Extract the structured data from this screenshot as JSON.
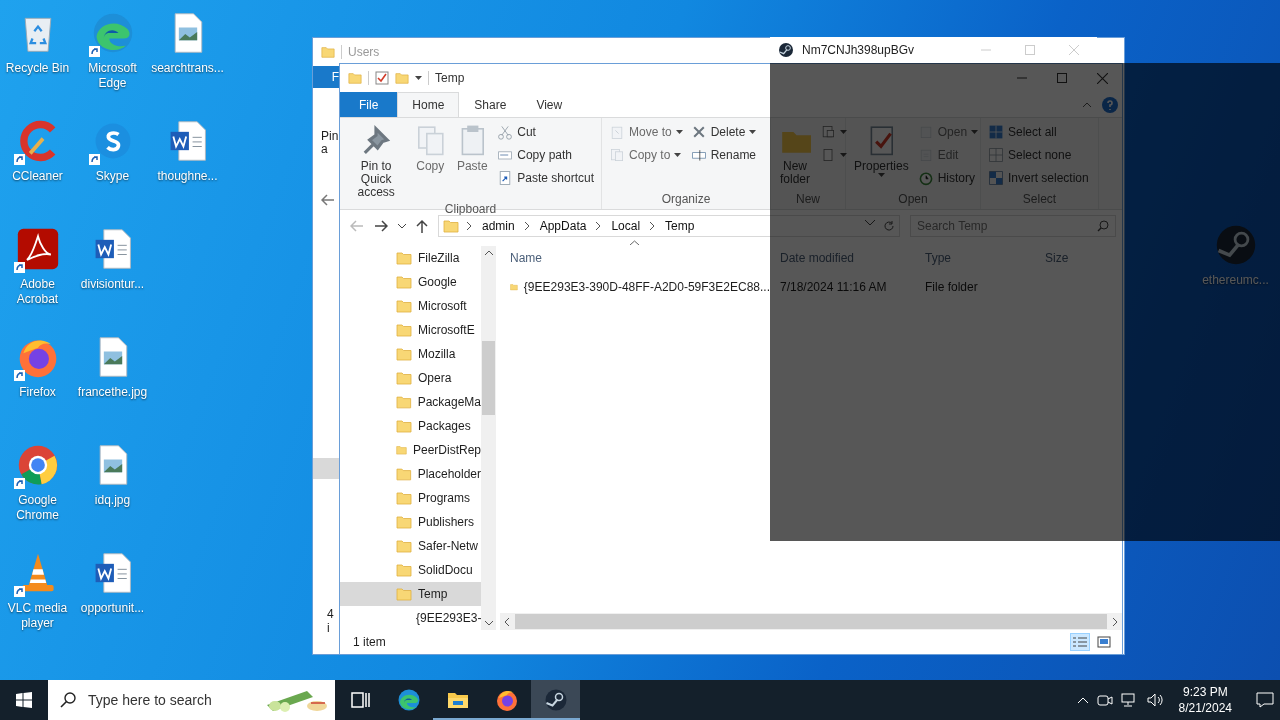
{
  "desktop_columns": [
    [
      {
        "label": "Recycle Bin",
        "kind": "recycle",
        "shortcut": false
      },
      {
        "label": "CCleaner",
        "kind": "ccleaner",
        "shortcut": true
      },
      {
        "label": "Adobe Acrobat",
        "kind": "acrobat",
        "shortcut": true
      },
      {
        "label": "Firefox",
        "kind": "firefox",
        "shortcut": true
      },
      {
        "label": "Google Chrome",
        "kind": "chrome",
        "shortcut": true
      },
      {
        "label": "VLC media player",
        "kind": "vlc",
        "shortcut": true
      }
    ],
    [
      {
        "label": "Microsoft Edge",
        "kind": "edge",
        "shortcut": true
      },
      {
        "label": "Skype",
        "kind": "skype",
        "shortcut": true
      },
      {
        "label": "divisiontur...",
        "kind": "word",
        "shortcut": false
      },
      {
        "label": "francethe.jpg",
        "kind": "image",
        "shortcut": false
      },
      {
        "label": "idq.jpg",
        "kind": "image",
        "shortcut": false
      },
      {
        "label": "opportunit...",
        "kind": "word",
        "shortcut": false
      }
    ],
    [
      {
        "label": "searchtrans...",
        "kind": "image",
        "shortcut": false
      },
      {
        "label": "thoughne...",
        "kind": "word",
        "shortcut": false
      }
    ]
  ],
  "right_icons": [
    {
      "label": "ethereumc...",
      "kind": "steam",
      "shortcut": false
    }
  ],
  "back_window": {
    "title": "Users",
    "file_tab": "F",
    "ribbon_lines": [
      "Pin",
      "a"
    ],
    "status": "4 i"
  },
  "explorer": {
    "title": "Temp",
    "tabs": [
      {
        "label": "File",
        "kind": "file",
        "selected": false
      },
      {
        "label": "Home",
        "kind": "tab",
        "selected": true
      },
      {
        "label": "Share",
        "kind": "tab",
        "selected": false
      },
      {
        "label": "View",
        "kind": "tab",
        "selected": false
      }
    ],
    "ribbon_groups": [
      {
        "label": "Clipboard",
        "columns": [
          [
            {
              "label": "Pin to Quick access",
              "kind": "large",
              "disabled": false,
              "menu": false
            }
          ],
          [
            {
              "label": "Copy",
              "kind": "large",
              "disabled": true,
              "menu": false
            }
          ],
          [
            {
              "label": "Paste",
              "kind": "large",
              "disabled": true,
              "menu": false
            }
          ],
          [
            {
              "label": "Cut",
              "kind": "small",
              "disabled": false,
              "menu": false
            },
            {
              "label": "Copy path",
              "kind": "small",
              "disabled": false,
              "menu": false
            },
            {
              "label": "Paste shortcut",
              "kind": "small",
              "disabled": false,
              "menu": false
            }
          ]
        ]
      },
      {
        "label": "Organize",
        "columns": [
          [
            {
              "label": "Move to",
              "kind": "small",
              "disabled": true,
              "menu": true
            },
            {
              "label": "Copy to",
              "kind": "small",
              "disabled": true,
              "menu": true
            }
          ],
          [
            {
              "label": "Delete",
              "kind": "small",
              "disabled": false,
              "menu": true
            },
            {
              "label": "Rename",
              "kind": "small",
              "disabled": false,
              "menu": false
            }
          ]
        ]
      },
      {
        "label": "New",
        "columns": [
          [
            {
              "label": "New folder",
              "kind": "large",
              "disabled": false,
              "menu": false
            }
          ],
          [
            {
              "kind": "small",
              "disabled": false,
              "menu": true
            },
            {
              "kind": "small",
              "disabled": false,
              "menu": true
            }
          ]
        ]
      },
      {
        "label": "Open",
        "columns": [
          [
            {
              "label": "Properties",
              "kind": "large",
              "disabled": false,
              "menu": true
            }
          ],
          [
            {
              "label": "Open",
              "kind": "small",
              "disabled": true,
              "menu": true
            },
            {
              "label": "Edit",
              "kind": "small",
              "disabled": true,
              "menu": false
            },
            {
              "label": "History",
              "kind": "small",
              "disabled": false,
              "menu": false
            }
          ]
        ]
      },
      {
        "label": "Select",
        "columns": [
          [
            {
              "label": "Select all",
              "kind": "small",
              "disabled": false,
              "menu": false
            },
            {
              "label": "Select none",
              "kind": "small",
              "disabled": false,
              "menu": false
            },
            {
              "label": "Invert selection",
              "kind": "small",
              "disabled": false,
              "menu": false
            }
          ]
        ]
      }
    ],
    "breadcrumbs": [
      "admin",
      "AppData",
      "Local",
      "Temp"
    ],
    "search": {
      "placeholder": "Search Temp"
    },
    "nav_tree": [
      {
        "label": "FileZilla",
        "selected": false
      },
      {
        "label": "Google",
        "selected": false
      },
      {
        "label": "Microsoft",
        "selected": false
      },
      {
        "label": "MicrosoftE",
        "selected": false
      },
      {
        "label": "Mozilla",
        "selected": false
      },
      {
        "label": "Opera",
        "selected": false
      },
      {
        "label": "PackageMa",
        "selected": false
      },
      {
        "label": "Packages",
        "selected": false
      },
      {
        "label": "PeerDistRep",
        "selected": false
      },
      {
        "label": "Placeholder",
        "selected": false
      },
      {
        "label": "Programs",
        "selected": false
      },
      {
        "label": "Publishers",
        "selected": false
      },
      {
        "label": "Safer-Netw",
        "selected": false
      },
      {
        "label": "SolidDocu",
        "selected": false
      },
      {
        "label": "Temp",
        "selected": true,
        "children": [
          {
            "label": "{9EE293E3-",
            "selected": false
          }
        ]
      }
    ],
    "columns": [
      {
        "label": "Name",
        "sorted": true
      },
      {
        "label": "Date modified",
        "sorted": false
      },
      {
        "label": "Type",
        "sorted": false
      },
      {
        "label": "Size",
        "sorted": false
      }
    ],
    "rows": [
      {
        "name": "{9EE293E3-390D-48FF-A2D0-59F3E2EC88...",
        "date": "7/18/2024 11:16 AM",
        "type": "File folder"
      }
    ],
    "status": "1 item",
    "views": [
      {
        "kind": "details",
        "selected": true
      },
      {
        "kind": "large",
        "selected": false
      }
    ]
  },
  "steam_window": {
    "title": "Nm7CNJh398upBGv"
  },
  "taskbar": {
    "search_placeholder": "Type here to search",
    "apps": [
      {
        "kind": "taskview",
        "running": false,
        "selected": false
      },
      {
        "kind": "edge",
        "running": false,
        "selected": false
      },
      {
        "kind": "explorer",
        "running": true,
        "selected": false
      },
      {
        "kind": "firefox",
        "running": true,
        "selected": false
      },
      {
        "kind": "steam",
        "running": true,
        "selected": true
      }
    ],
    "time": "9:23 PM",
    "date": "8/21/2024"
  }
}
